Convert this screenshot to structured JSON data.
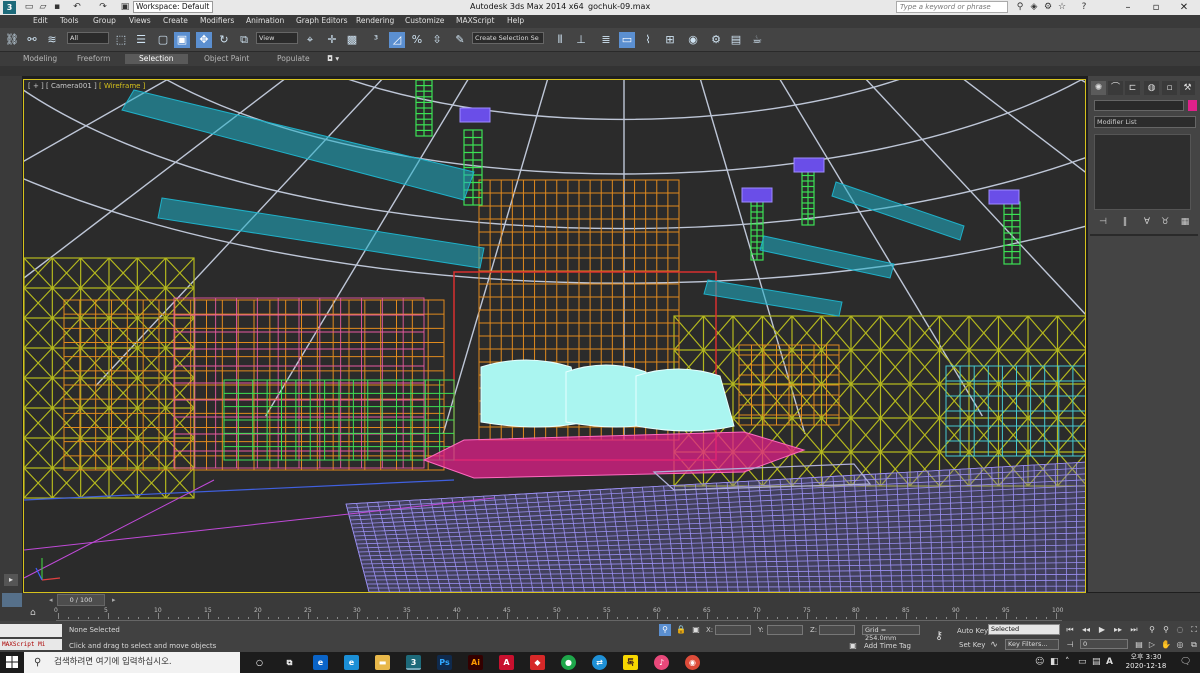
{
  "titlebar": {
    "app_logo": "3ds-max-logo",
    "workspace": "Workspace: Default",
    "title": "Autodesk 3ds Max  2014 x64",
    "file": "gochuk-09.max",
    "search_placeholder": "Type a keyword or phrase"
  },
  "menu": [
    "Edit",
    "Tools",
    "Group",
    "Views",
    "Create",
    "Modifiers",
    "Animation",
    "Graph Editors",
    "Rendering",
    "Customize",
    "MAXScript",
    "Help"
  ],
  "toolbar": {
    "filter_value": "All",
    "ref_coord_value": "View",
    "selection_set_value": "Create Selection Se"
  },
  "ribbon": {
    "tabs": [
      "Modeling",
      "Freeform",
      "Selection",
      "Object Paint",
      "Populate"
    ],
    "selected": "Selection"
  },
  "viewport": {
    "label_a": "[ + ] [ Camera001 ]",
    "label_b": "[ Wireframe ]",
    "colors": {
      "dome": "#d8e2f5",
      "truss_cyan": "#1fb0c8",
      "rig_green": "#3ce054",
      "stand_yellow": "#b4b81e",
      "scaffold_orange": "#e08a1e",
      "floor_purple": "#9a8ff0",
      "screen_cyan": "#aaf5f0",
      "stage_magenta": "#e0208a",
      "lamp_purple": "#6a4ee8"
    }
  },
  "command_panel": {
    "modifier_list": "Modifier List"
  },
  "timeline": {
    "position": "0 / 100",
    "ticks": [
      "0",
      "5",
      "10",
      "15",
      "20",
      "25",
      "30",
      "35",
      "40",
      "45",
      "50",
      "55",
      "60",
      "65",
      "70",
      "75",
      "80",
      "85",
      "90",
      "95",
      "100"
    ]
  },
  "status": {
    "maxscript_label": "MAXScript Mi",
    "selection_status": "None Selected",
    "prompt": "Click and drag to select and move objects",
    "x_label": "X:",
    "y_label": "Y:",
    "z_label": "Z:",
    "grid": "Grid = 254.0mm",
    "add_time_tag": "Add Time Tag",
    "auto_key": "Auto Key",
    "set_key": "Set Key",
    "selected_option": "Selected",
    "key_filters": "Key Filters...",
    "frame_value": "0"
  },
  "taskbar": {
    "search_text": "검색하려면 여기에 입력하십시오.",
    "time": "오후 3:30",
    "date": "2020-12-18"
  }
}
